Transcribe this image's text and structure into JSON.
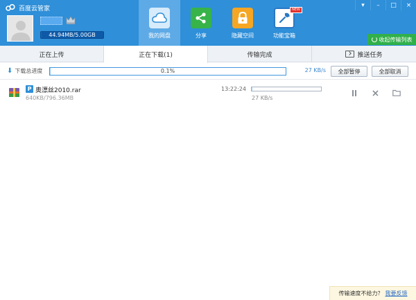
{
  "app": {
    "title": "百度云管家",
    "window_controls": {
      "menu": "▾",
      "minimize": "–",
      "maximize": "□",
      "close": "×"
    }
  },
  "user": {
    "quota_text": "44.94MB/5.00GB",
    "quota_used_fraction": 0.009
  },
  "nav": {
    "items": [
      {
        "label": "我的网盘",
        "icon": "cloud-icon",
        "active": true
      },
      {
        "label": "分享",
        "icon": "share-icon",
        "active": false
      },
      {
        "label": "隐藏空间",
        "icon": "lock-icon",
        "active": false
      },
      {
        "label": "功能宝箱",
        "icon": "toolbox-icon",
        "badge": "NEW",
        "active": false
      }
    ]
  },
  "collapse_button": {
    "label": "收起传输列表"
  },
  "tabs": [
    {
      "label": "正在上传"
    },
    {
      "label": "正在下载(1)",
      "active": true
    },
    {
      "label": "传输完成"
    },
    {
      "label": "推送任务",
      "icon": "push-icon"
    }
  ],
  "total": {
    "label": "下载总进度",
    "percent_text": "0.1%",
    "percent": 0.1,
    "speed": "27 KB/s",
    "pause_all": "全部暂停",
    "cancel_all": "全部取消"
  },
  "downloads": [
    {
      "type_badge": "P",
      "name": "奥漂丝2010.rar",
      "size": "640KB/796.36MB",
      "time": "13:22:24",
      "progress_fraction": 0.001,
      "speed": "27 KB/s"
    }
  ],
  "item_actions": {
    "pause": "pause-icon",
    "cancel": "close-icon",
    "folder": "folder-icon"
  },
  "feedback": {
    "text": "传输速度不给力？",
    "link": "我要反馈"
  },
  "colors": {
    "header": "#2f8fd8",
    "nav_active": "#5eaae6",
    "collapse_green": "#31b04a",
    "progress_fill": "#9fd0f5"
  }
}
